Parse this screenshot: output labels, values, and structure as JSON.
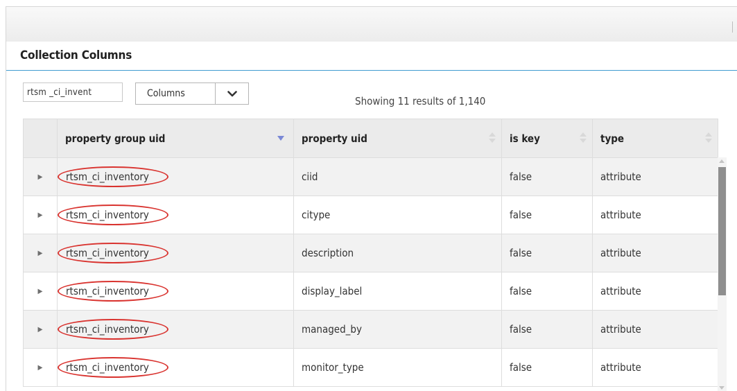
{
  "panel": {
    "title": "Collection Columns"
  },
  "filter": {
    "search_value": "rtsm _ci_invent",
    "columns_select": "Columns"
  },
  "results_text": "Showing 11 results of 1,140",
  "table": {
    "headers": [
      "property group uid",
      "property uid",
      "is key",
      "type"
    ],
    "rows": [
      {
        "group": "rtsm_ci_inventory",
        "property": "ciid",
        "is_key": "false",
        "type": "attribute"
      },
      {
        "group": "rtsm_ci_inventory",
        "property": "citype",
        "is_key": "false",
        "type": "attribute"
      },
      {
        "group": "rtsm_ci_inventory",
        "property": "description",
        "is_key": "false",
        "type": "attribute"
      },
      {
        "group": "rtsm_ci_inventory",
        "property": "display_label",
        "is_key": "false",
        "type": "attribute"
      },
      {
        "group": "rtsm_ci_inventory",
        "property": "managed_by",
        "is_key": "false",
        "type": "attribute"
      },
      {
        "group": "rtsm_ci_inventory",
        "property": "monitor_type",
        "is_key": "false",
        "type": "attribute"
      }
    ]
  },
  "colors": {
    "accent_rule": "#3f9bd1",
    "annotation_oval": "#d9332f",
    "sort_active": "#7a88d6"
  },
  "icons": {
    "expand": "caret-right-icon",
    "dropdown": "chevron-down-icon"
  }
}
